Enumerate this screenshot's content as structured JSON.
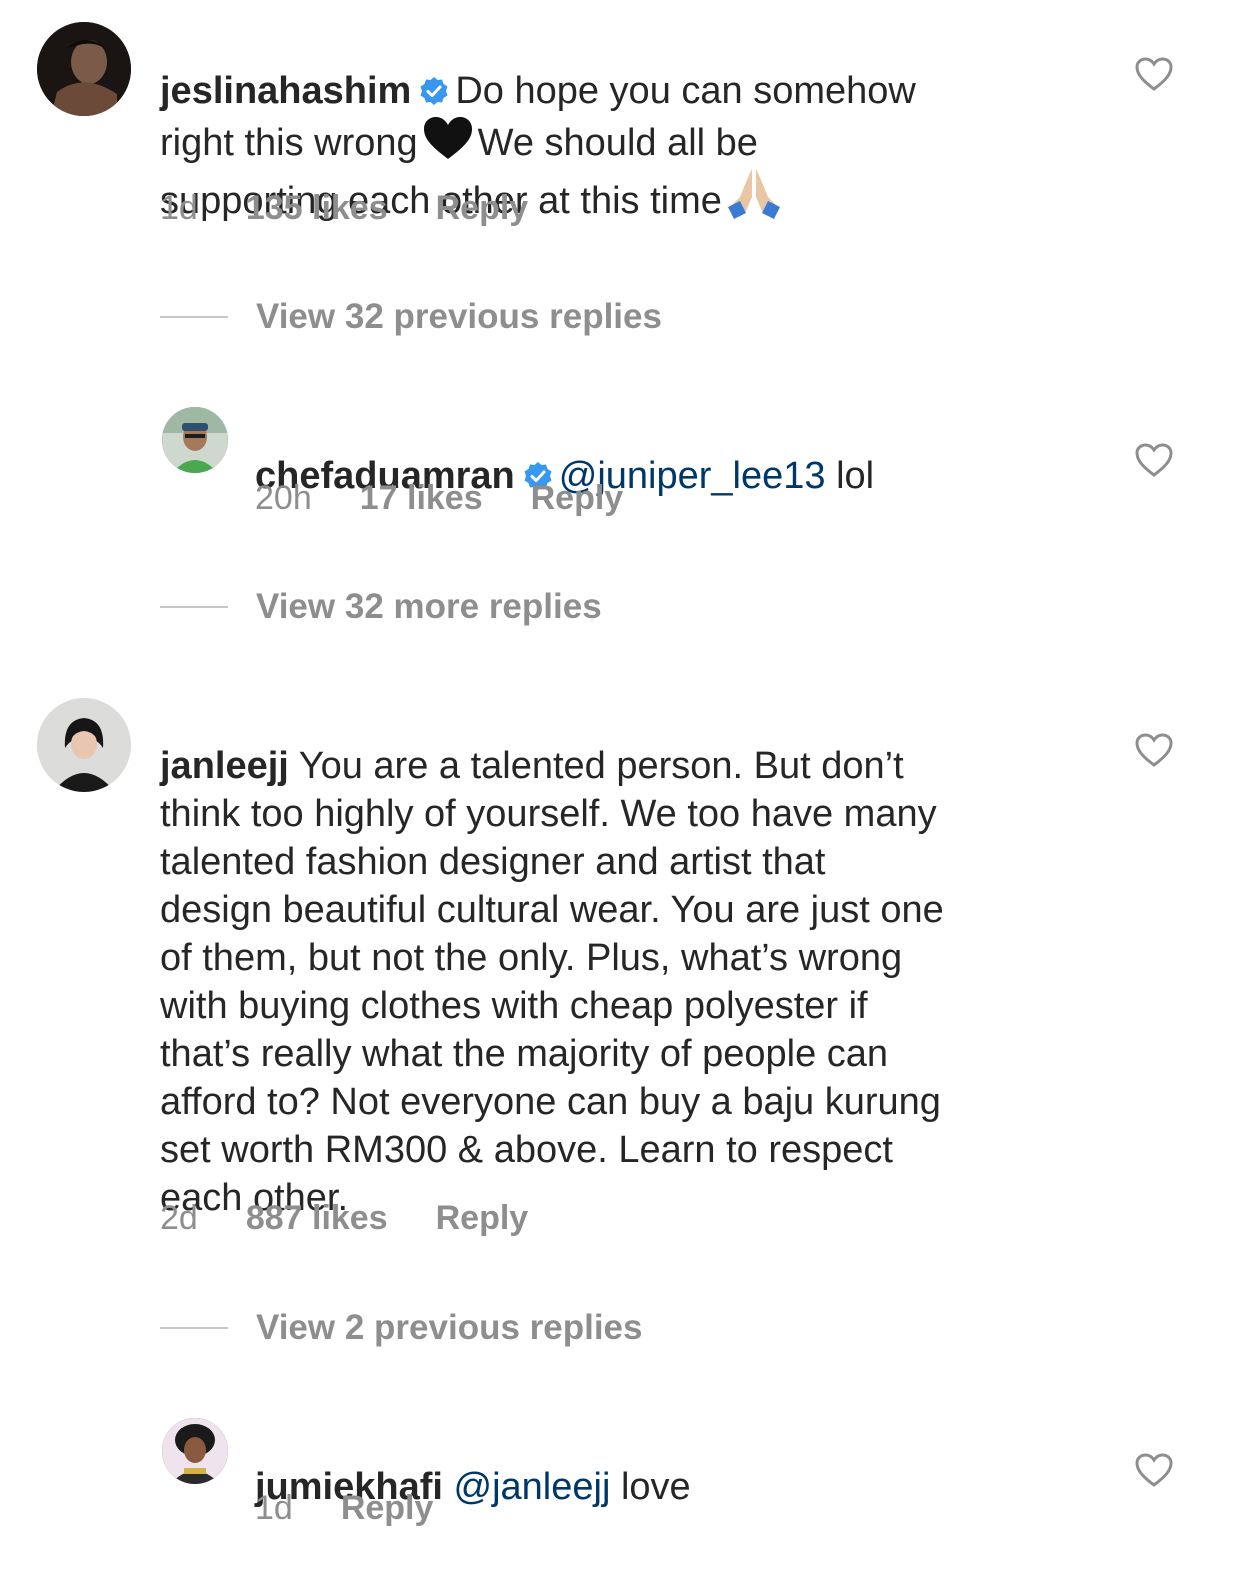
{
  "comments": [
    {
      "username": "jeslinahashim",
      "verified": true,
      "text_part1": "Do hope you can somehow\nright this wrong",
      "emoji1": "black-heart",
      "text_part2": "We should all be\nsupporting each other at this time",
      "emoji2": "folded-hands",
      "time": "1d",
      "likes": "135 likes",
      "reply": "Reply"
    },
    {
      "username": "chefaduamran",
      "verified": true,
      "mention": "@juniper_lee13",
      "text": "lol",
      "time": "20h",
      "likes": "17 likes",
      "reply": "Reply"
    },
    {
      "username": "janleejj",
      "text": "You are a talented person. But don’t\nthink too highly of yourself. We too have many\ntalented fashion designer and artist that\ndesign beautiful cultural wear. You are just one\nof them, but not the only. Plus, what’s wrong\nwith buying clothes with cheap polyester if\nthat’s really what the majority of people can\nafford to? Not everyone can buy a baju kurung\nset worth RM300 & above. Learn to respect\neach other.",
      "time": "2d",
      "likes": "887 likes",
      "reply": "Reply"
    },
    {
      "username": "jumiekhafi",
      "mention": "@janleejj",
      "text": "love",
      "time": "1d",
      "reply": "Reply"
    }
  ],
  "thread_toggles": [
    "View 32 previous replies",
    "View 32 more replies",
    "View 2 previous replies"
  ],
  "colors": {
    "text": "#262626",
    "secondary": "#8e8e8e",
    "mention": "#00376b",
    "verified": "#3897f0"
  }
}
